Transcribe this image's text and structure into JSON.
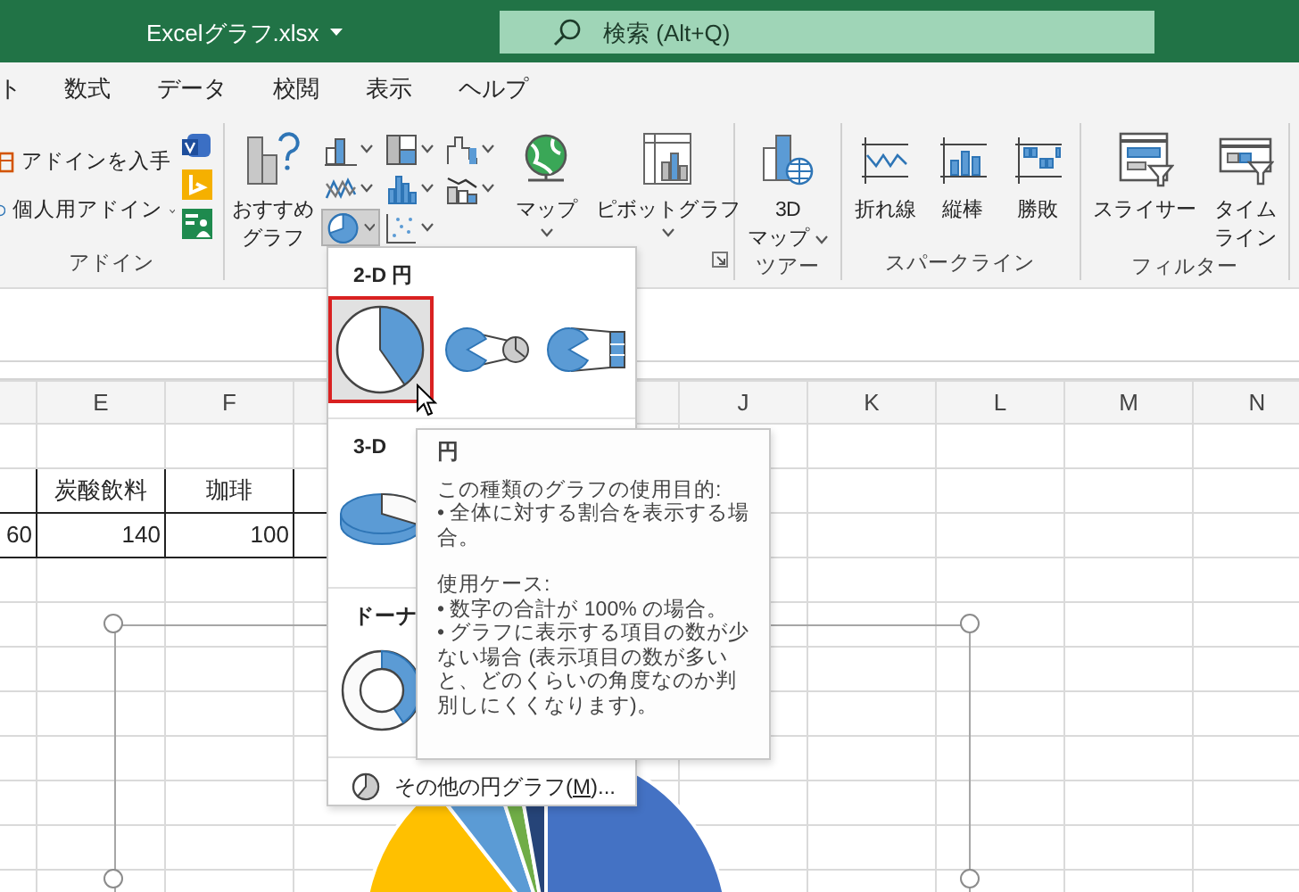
{
  "title_bar": {
    "title": "Excelグラフ.xlsx",
    "search_placeholder": "検索 (Alt+Q)"
  },
  "tabs": [
    {
      "label": "ト",
      "selected": false
    },
    {
      "label": "数式",
      "selected": false
    },
    {
      "label": "データ",
      "selected": false
    },
    {
      "label": "校閲",
      "selected": false
    },
    {
      "label": "表示",
      "selected": false
    },
    {
      "label": "ヘルプ",
      "selected": false
    }
  ],
  "ribbon": {
    "groups": [
      {
        "kind": "addins",
        "label": "アドイン",
        "buttons": [
          {
            "kind": "store",
            "label": "アドインを入手",
            "dropdown": false
          },
          {
            "kind": "myaddins",
            "label": "個人用アドイン",
            "dropdown": true
          }
        ]
      },
      {
        "kind": "charts",
        "recommended": {
          "label_lines": [
            "おすすめ",
            "グラフ"
          ]
        },
        "chart_types": [
          {
            "kind": "column",
            "selected": false
          },
          {
            "kind": "hierarchy",
            "selected": false
          },
          {
            "kind": "waterfall",
            "selected": false
          },
          {
            "kind": "line",
            "selected": false
          },
          {
            "kind": "statistic",
            "selected": false
          },
          {
            "kind": "combo",
            "selected": false
          },
          {
            "kind": "pie",
            "selected": true
          },
          {
            "kind": "scatter",
            "selected": false
          }
        ],
        "large_buttons": [
          {
            "kind": "map",
            "label_lines": [
              "マップ"
            ],
            "dropdown": true
          },
          {
            "kind": "pivotchart",
            "label_lines": [
              "ピボットグラフ"
            ],
            "dropdown": true
          }
        ]
      },
      {
        "kind": "large",
        "label": "ツアー",
        "buttons": [
          {
            "kind": "tourmap",
            "label_lines": [
              "3D",
              "マップ"
            ],
            "dropdown": true
          }
        ]
      },
      {
        "kind": "large",
        "label": "スパークライン",
        "buttons": [
          {
            "kind": "sparkline",
            "label_lines": [
              "折れ線"
            ],
            "dropdown": false
          },
          {
            "kind": "sparkcolumn",
            "label_lines": [
              "縦棒"
            ],
            "dropdown": false
          },
          {
            "kind": "winloss",
            "label_lines": [
              "勝敗"
            ],
            "dropdown": false
          }
        ]
      },
      {
        "kind": "large",
        "label": "フィルター",
        "buttons": [
          {
            "kind": "slicer",
            "label_lines": [
              "スライサー"
            ],
            "dropdown": false
          },
          {
            "kind": "timeline",
            "label_lines": [
              "タイム",
              "ライン"
            ],
            "dropdown": false
          }
        ]
      }
    ]
  },
  "sheet": {
    "column_headers_left": [
      "E",
      "F"
    ],
    "column_headers_right": [
      "J",
      "K",
      "L",
      "M",
      "N"
    ],
    "header_cells": [
      "炭酸飲料",
      "珈琲"
    ],
    "value_cells": [
      "60",
      "140",
      "100"
    ]
  },
  "pie_menu": {
    "sections": [
      {
        "heading": "2-D 円",
        "items": [
          {
            "kind": "pie",
            "selected": true
          },
          {
            "kind": "pieofpie",
            "selected": false
          },
          {
            "kind": "barofpie",
            "selected": false
          }
        ]
      },
      {
        "heading": "3-D",
        "items": [
          {
            "kind": "pie3d",
            "selected": false
          }
        ]
      },
      {
        "heading": "ドーナ",
        "items": [
          {
            "kind": "doughnut",
            "selected": false
          }
        ]
      }
    ],
    "more_option": {
      "label_before": "その他の円グラフ(",
      "access_key": "M",
      "label_after": ")..."
    }
  },
  "tooltip": {
    "title": "円",
    "paragraphs": [
      [
        "この種類のグラフの使用目的:",
        "• 全体に対する割合を表示する場合。"
      ],
      [
        "使用ケース:",
        "• 数字の合計が 100% の場合。",
        "• グラフに表示する項目の数が少ない場合 (表示項目の数が多いと、どのくらいの角度なのか判別しにくくなります)。"
      ]
    ]
  }
}
